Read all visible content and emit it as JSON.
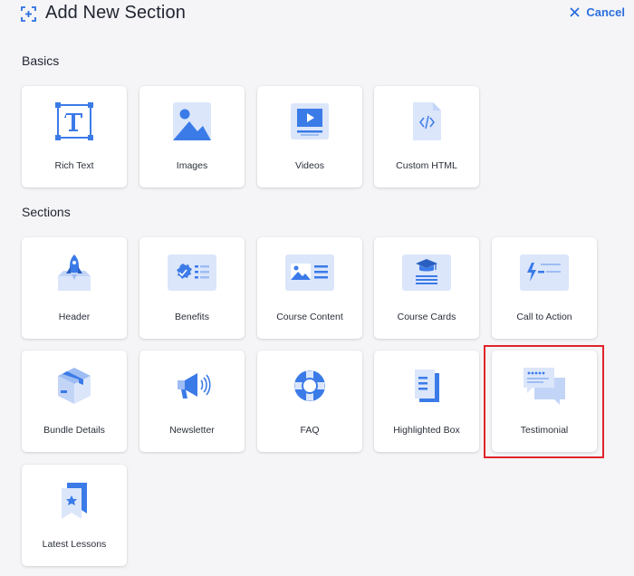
{
  "header": {
    "title": "Add New Section",
    "cancel_label": "Cancel"
  },
  "groups": {
    "basics": {
      "label": "Basics",
      "items": [
        {
          "label": "Rich Text",
          "icon": "rich-text-icon"
        },
        {
          "label": "Images",
          "icon": "images-icon"
        },
        {
          "label": "Videos",
          "icon": "videos-icon"
        },
        {
          "label": "Custom HTML",
          "icon": "custom-html-icon"
        }
      ]
    },
    "sections": {
      "label": "Sections",
      "items": [
        {
          "label": "Header",
          "icon": "rocket-icon"
        },
        {
          "label": "Benefits",
          "icon": "benefits-icon"
        },
        {
          "label": "Course Content",
          "icon": "course-content-icon"
        },
        {
          "label": "Course Cards",
          "icon": "course-cards-icon"
        },
        {
          "label": "Call to Action",
          "icon": "call-to-action-icon"
        },
        {
          "label": "Bundle Details",
          "icon": "bundle-box-icon"
        },
        {
          "label": "Newsletter",
          "icon": "megaphone-icon"
        },
        {
          "label": "FAQ",
          "icon": "lifebuoy-icon"
        },
        {
          "label": "Highlighted Box",
          "icon": "highlighted-box-icon"
        },
        {
          "label": "Testimonial",
          "icon": "testimonial-icon"
        },
        {
          "label": "Latest Lessons",
          "icon": "bookmark-star-icon"
        }
      ]
    }
  },
  "colors": {
    "accent": "#2b6fde",
    "icon_light": "#dbe6fb",
    "highlight_border": "#e0242b"
  }
}
